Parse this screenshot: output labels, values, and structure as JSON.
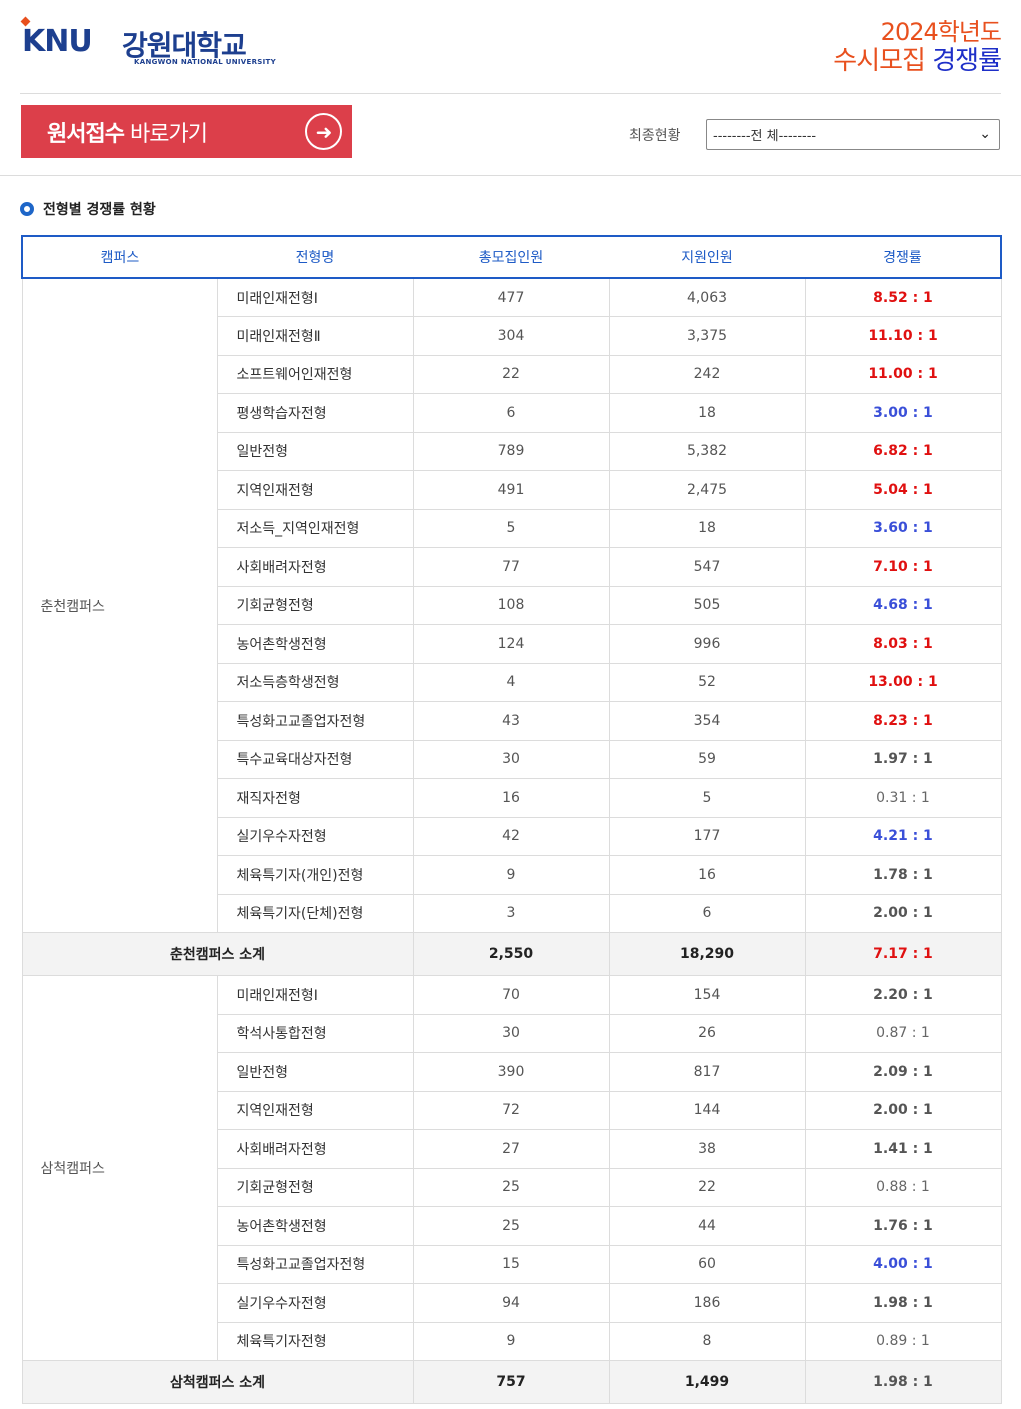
{
  "header": {
    "logo_knu": "KNU",
    "logo_kr": "강원대학교",
    "logo_en": "KANGWON NATIONAL UNIVERSITY",
    "title_year": "2024학년도",
    "title_part1": "수시모집",
    "title_part2": "경쟁률"
  },
  "toolbar": {
    "apply_bold": "원서접수",
    "apply_rest": "바로가기",
    "status_label": "최종현황",
    "select_value": "--------전 체--------"
  },
  "section": {
    "title": "전형별 경쟁률 현황"
  },
  "table": {
    "headers": [
      "캠퍼스",
      "전형명",
      "총모집인원",
      "지원인원",
      "경쟁률"
    ],
    "groups": [
      {
        "campus": "춘천캠퍼스",
        "rows": [
          {
            "name": "미래인재전형Ⅰ",
            "quota": "477",
            "applicants": "4,063",
            "ratio": "8.52 : 1",
            "tone": "red"
          },
          {
            "name": "미래인재전형Ⅱ",
            "quota": "304",
            "applicants": "3,375",
            "ratio": "11.10 : 1",
            "tone": "red"
          },
          {
            "name": "소프트웨어인재전형",
            "quota": "22",
            "applicants": "242",
            "ratio": "11.00 : 1",
            "tone": "red"
          },
          {
            "name": "평생학습자전형",
            "quota": "6",
            "applicants": "18",
            "ratio": "3.00 : 1",
            "tone": "blue"
          },
          {
            "name": "일반전형",
            "quota": "789",
            "applicants": "5,382",
            "ratio": "6.82 : 1",
            "tone": "red"
          },
          {
            "name": "지역인재전형",
            "quota": "491",
            "applicants": "2,475",
            "ratio": "5.04 : 1",
            "tone": "red"
          },
          {
            "name": "저소득_지역인재전형",
            "quota": "5",
            "applicants": "18",
            "ratio": "3.60 : 1",
            "tone": "blue"
          },
          {
            "name": "사회배려자전형",
            "quota": "77",
            "applicants": "547",
            "ratio": "7.10 : 1",
            "tone": "red"
          },
          {
            "name": "기회균형전형",
            "quota": "108",
            "applicants": "505",
            "ratio": "4.68 : 1",
            "tone": "blue"
          },
          {
            "name": "농어촌학생전형",
            "quota": "124",
            "applicants": "996",
            "ratio": "8.03 : 1",
            "tone": "red"
          },
          {
            "name": "저소득층학생전형",
            "quota": "4",
            "applicants": "52",
            "ratio": "13.00 : 1",
            "tone": "red"
          },
          {
            "name": "특성화고교졸업자전형",
            "quota": "43",
            "applicants": "354",
            "ratio": "8.23 : 1",
            "tone": "red"
          },
          {
            "name": "특수교육대상자전형",
            "quota": "30",
            "applicants": "59",
            "ratio": "1.97 : 1",
            "tone": "dark"
          },
          {
            "name": "재직자전형",
            "quota": "16",
            "applicants": "5",
            "ratio": "0.31 : 1",
            "tone": "light"
          },
          {
            "name": "실기우수자전형",
            "quota": "42",
            "applicants": "177",
            "ratio": "4.21 : 1",
            "tone": "blue"
          },
          {
            "name": "체육특기자(개인)전형",
            "quota": "9",
            "applicants": "16",
            "ratio": "1.78 : 1",
            "tone": "dark"
          },
          {
            "name": "체육특기자(단체)전형",
            "quota": "3",
            "applicants": "6",
            "ratio": "2.00 : 1",
            "tone": "dark"
          }
        ],
        "subtotal": {
          "label": "춘천캠퍼스 소계",
          "quota": "2,550",
          "applicants": "18,290",
          "ratio": "7.17 : 1",
          "tone": "red"
        }
      },
      {
        "campus": "삼척캠퍼스",
        "rows": [
          {
            "name": "미래인재전형Ⅰ",
            "quota": "70",
            "applicants": "154",
            "ratio": "2.20 : 1",
            "tone": "dark"
          },
          {
            "name": "학석사통합전형",
            "quota": "30",
            "applicants": "26",
            "ratio": "0.87 : 1",
            "tone": "light"
          },
          {
            "name": "일반전형",
            "quota": "390",
            "applicants": "817",
            "ratio": "2.09 : 1",
            "tone": "dark"
          },
          {
            "name": "지역인재전형",
            "quota": "72",
            "applicants": "144",
            "ratio": "2.00 : 1",
            "tone": "dark"
          },
          {
            "name": "사회배려자전형",
            "quota": "27",
            "applicants": "38",
            "ratio": "1.41 : 1",
            "tone": "dark"
          },
          {
            "name": "기회균형전형",
            "quota": "25",
            "applicants": "22",
            "ratio": "0.88 : 1",
            "tone": "light"
          },
          {
            "name": "농어촌학생전형",
            "quota": "25",
            "applicants": "44",
            "ratio": "1.76 : 1",
            "tone": "dark"
          },
          {
            "name": "특성화고교졸업자전형",
            "quota": "15",
            "applicants": "60",
            "ratio": "4.00 : 1",
            "tone": "blue"
          },
          {
            "name": "실기우수자전형",
            "quota": "94",
            "applicants": "186",
            "ratio": "1.98 : 1",
            "tone": "dark"
          },
          {
            "name": "체육특기자전형",
            "quota": "9",
            "applicants": "8",
            "ratio": "0.89 : 1",
            "tone": "light"
          }
        ],
        "subtotal": {
          "label": "삼척캠퍼스 소계",
          "quota": "757",
          "applicants": "1,499",
          "ratio": "1.98 : 1",
          "tone": "dark"
        }
      }
    ]
  }
}
